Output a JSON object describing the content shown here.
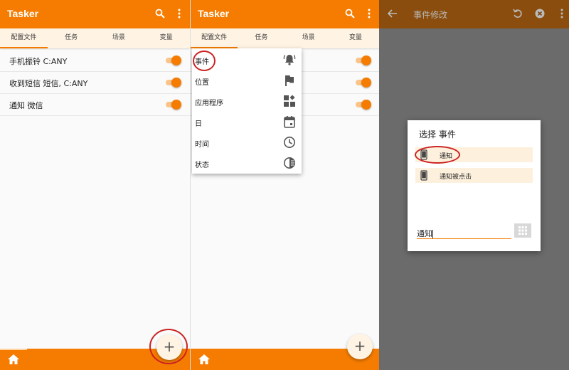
{
  "colors": {
    "accent": "#f57c00",
    "accent_light": "#fff3e3",
    "annotation": "#cc2222"
  },
  "app_title": "Tasker",
  "tabs": [
    "配置文件",
    "任务",
    "场景",
    "变量"
  ],
  "profiles": [
    {
      "label": "手机振铃 C:ANY",
      "enabled": true
    },
    {
      "label": "收到短信 短信, C:ANY",
      "enabled": true
    },
    {
      "label": "通知 微信",
      "enabled": true
    }
  ],
  "fab_label": "+",
  "context_menu": [
    {
      "label": "事件",
      "icon": "bell-alert-icon"
    },
    {
      "label": "位置",
      "icon": "flag-icon"
    },
    {
      "label": "应用程序",
      "icon": "apps-widgets-icon"
    },
    {
      "label": "日",
      "icon": "calendar-icon"
    },
    {
      "label": "时间",
      "icon": "clock-icon"
    },
    {
      "label": "状态",
      "icon": "contrast-icon"
    }
  ],
  "screen3": {
    "title": "事件修改",
    "dialog": {
      "title": "选择 事件",
      "items": [
        {
          "label": "通知",
          "icon": "phone-icon"
        },
        {
          "label": "通知被点击",
          "icon": "phone-icon"
        }
      ],
      "filter_value": "通知"
    }
  }
}
